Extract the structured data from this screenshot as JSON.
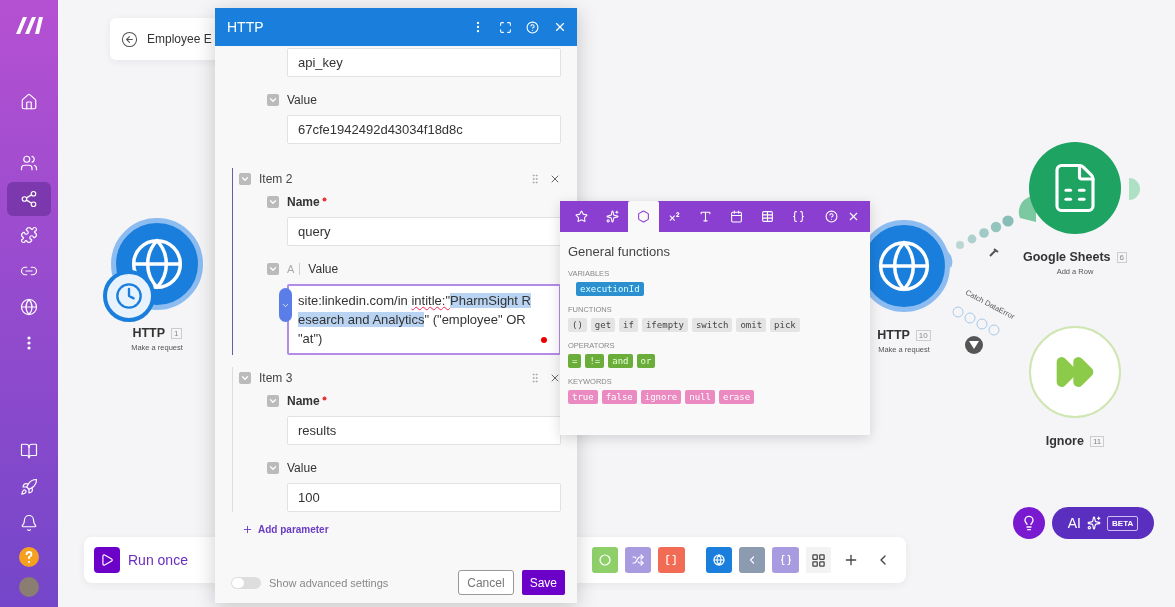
{
  "sidebar": {
    "items": [
      {
        "selected": false
      },
      {
        "selected": false
      },
      {
        "selected": true
      },
      {
        "selected": false
      },
      {
        "selected": false
      },
      {
        "selected": false
      },
      {
        "selected": false
      }
    ],
    "bottom_items": [
      {
        "selected": false
      },
      {
        "selected": false
      },
      {
        "selected": false
      }
    ]
  },
  "scenario_title": "Employee E",
  "nodes": [
    {
      "kind": "http",
      "title": "HTTP",
      "number": "1",
      "subtitle": "Make a request",
      "scheduled": true
    },
    {
      "kind": "http",
      "title": "HTTP",
      "number": "10",
      "subtitle": "Make a request",
      "scheduled": false
    },
    {
      "kind": "sheets",
      "title": "Google Sheets",
      "number": "6",
      "subtitle": "Add a Row",
      "scheduled": false
    },
    {
      "kind": "ignore",
      "title": "Ignore",
      "number": "11",
      "scheduled": false
    }
  ],
  "route_label": "Catch DataError",
  "dialog": {
    "title": "HTTP",
    "items": [
      {
        "name_value": "api_key",
        "value_label": "Value",
        "value_parts": [
          {
            "kind": "plain",
            "text": "67cfe1942492d43034f18d8c"
          }
        ],
        "focused": false
      },
      {
        "label": "Item 2",
        "name_label": "Name",
        "name_required": true,
        "name_value": "query",
        "value_label": "Value",
        "type_marker": "A",
        "focused": true,
        "value_parts": [
          {
            "kind": "plain",
            "text": "site:linkedin.com/in "
          },
          {
            "kind": "underlined",
            "text": "intitle:\""
          },
          {
            "kind": "selected",
            "text": "PharmSight Research and Analytics"
          },
          {
            "kind": "plain",
            "text": "\" (\"employee\" OR \"at\")"
          }
        ]
      },
      {
        "label": "Item 3",
        "name_label": "Name",
        "name_required": true,
        "name_value": "results",
        "value_label": "Value",
        "focused": false,
        "value_parts": [
          {
            "kind": "plain",
            "text": "100"
          }
        ]
      }
    ],
    "add_parameter": "Add parameter",
    "advanced": {
      "label": "Show advanced settings",
      "on": false
    },
    "cancel": "Cancel",
    "save": "Save"
  },
  "function_panel": {
    "tabs": [
      {
        "selected": false
      },
      {
        "selected": false
      },
      {
        "selected": true
      },
      {
        "selected": false
      },
      {
        "selected": false
      },
      {
        "selected": false
      },
      {
        "selected": false
      },
      {
        "selected": false
      }
    ],
    "title": "General functions",
    "sections": [
      {
        "label": "VARIABLES",
        "kind": "variable",
        "tokens": [
          "executionId"
        ]
      },
      {
        "label": "FUNCTIONS",
        "kind": "function",
        "tokens": [
          "()",
          "get",
          "if",
          "ifempty",
          "switch",
          "omit",
          "pick"
        ]
      },
      {
        "label": "OPERATORS",
        "kind": "operator",
        "tokens": [
          "=",
          "!=",
          "and",
          "or"
        ]
      },
      {
        "label": "KEYWORDS",
        "kind": "keyword",
        "tokens": [
          "true",
          "false",
          "ignore",
          "null",
          "erase"
        ]
      }
    ]
  },
  "toolbar": {
    "run_label": "Run once",
    "tools": [
      {
        "color": "#8fcf6a"
      },
      {
        "color": "#a99be0"
      },
      {
        "color": "#f26b55"
      },
      {
        "color": "#1a7fdc"
      },
      {
        "color": "#8d9bb0"
      },
      {
        "color": "#a99be0"
      }
    ]
  },
  "ai_button": {
    "label": "AI",
    "badge": "BETA"
  }
}
